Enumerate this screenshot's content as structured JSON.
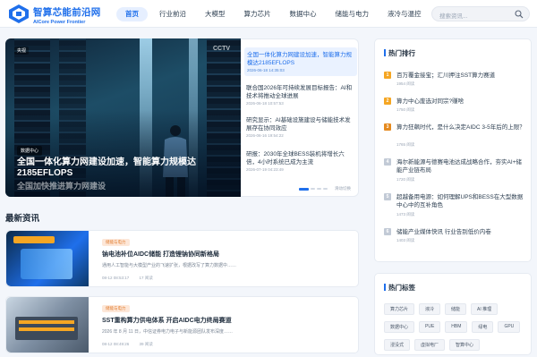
{
  "brand": {
    "name": "智算芯能前沿网",
    "en": "AICore Power Frontier"
  },
  "nav": [
    "首页",
    "行业前沿",
    "大模型",
    "算力芯片",
    "数据中心",
    "储能与电力",
    "液冷与温控"
  ],
  "search": {
    "placeholder": "搜索资讯..."
  },
  "hero": {
    "badge": "数据中心",
    "title": "全国一体化算力网建设加速，智能算力规模达2185EFLOPS",
    "caption": "全国加快推进算力网建设",
    "cctv": "CCTV",
    "chip": "央视"
  },
  "side": [
    {
      "title": "全国一体化算力网建设加速，智能算力规模达2185EFLOPS",
      "date": "2026-06-18 14:35:03"
    },
    {
      "title": "联合国2026年可持续发展目标报告：AI和技术将推动全球进展",
      "date": "2026-06-18 10:57:53"
    },
    {
      "title": "研究显示：AI基础设施建设与储能技术发展存在协同效应",
      "date": "2026-06-16 19:54:22"
    },
    {
      "title": "研报：2030年全球BESS装机将增长六倍，4小时系统已成为主流",
      "date": "2026-07-19 04:23:49"
    }
  ],
  "slider_label": "滑动切换",
  "latest": {
    "title": "最新资讯"
  },
  "news": [
    {
      "tag": "储能与电力",
      "title": "钠电池补位AIDC储能 打造锂钠协同新格局",
      "summary": "通用人工智能与大模型产业的飞速扩张，根据改写了算力数据中……",
      "date": "08-12 08:53:17",
      "views": "17 阅读"
    },
    {
      "tag": "储能与电力",
      "title": "SST重构算力供电体系 开启AIDC电力终局赛道",
      "summary": "2026 年 8 月 11 日，中信证券电力电子与新能源团队发布深度……",
      "date": "08-12 08:49:26",
      "views": "39 阅读"
    }
  ],
  "hot": {
    "title": "热门排行",
    "items": [
      {
        "n": "1",
        "title": "百万覆金接宝；汇川押注SST算力赛道",
        "views": "1954 阅读",
        "color": "#f5a623"
      },
      {
        "n": "2",
        "title": "算力中心废选对同宗?赚啥",
        "views": "1750 阅读",
        "color": "#f5a623"
      },
      {
        "n": "3",
        "title": "算力狂飙时代，是什么决定AIDC 3-5年后的上限？",
        "views": "1765 阅读",
        "color": "#e58a1f"
      },
      {
        "n": "4",
        "title": "海尔新能源与德赛电池达成战略合作，夯实AI+储能产业链布局",
        "views": "1720 阅读",
        "color": "#c2cad6"
      },
      {
        "n": "5",
        "title": "超越备用电源：如何理解UPS和BESS在大型数据中心中的互补角色",
        "views": "1473 阅读",
        "color": "#c2cad6"
      },
      {
        "n": "6",
        "title": "储能产业媒体快讯 行业告别低价内卷",
        "views": "1403 阅读",
        "color": "#c2cad6"
      }
    ]
  },
  "tags": {
    "title": "热门标签",
    "items": [
      "算力芯片",
      "液冷",
      "储能",
      "AI 推理",
      "数据中心",
      "PUE",
      "HBM",
      "绿电",
      "GPU",
      "浸没式",
      "虚拟电厂",
      "智算中心"
    ]
  }
}
